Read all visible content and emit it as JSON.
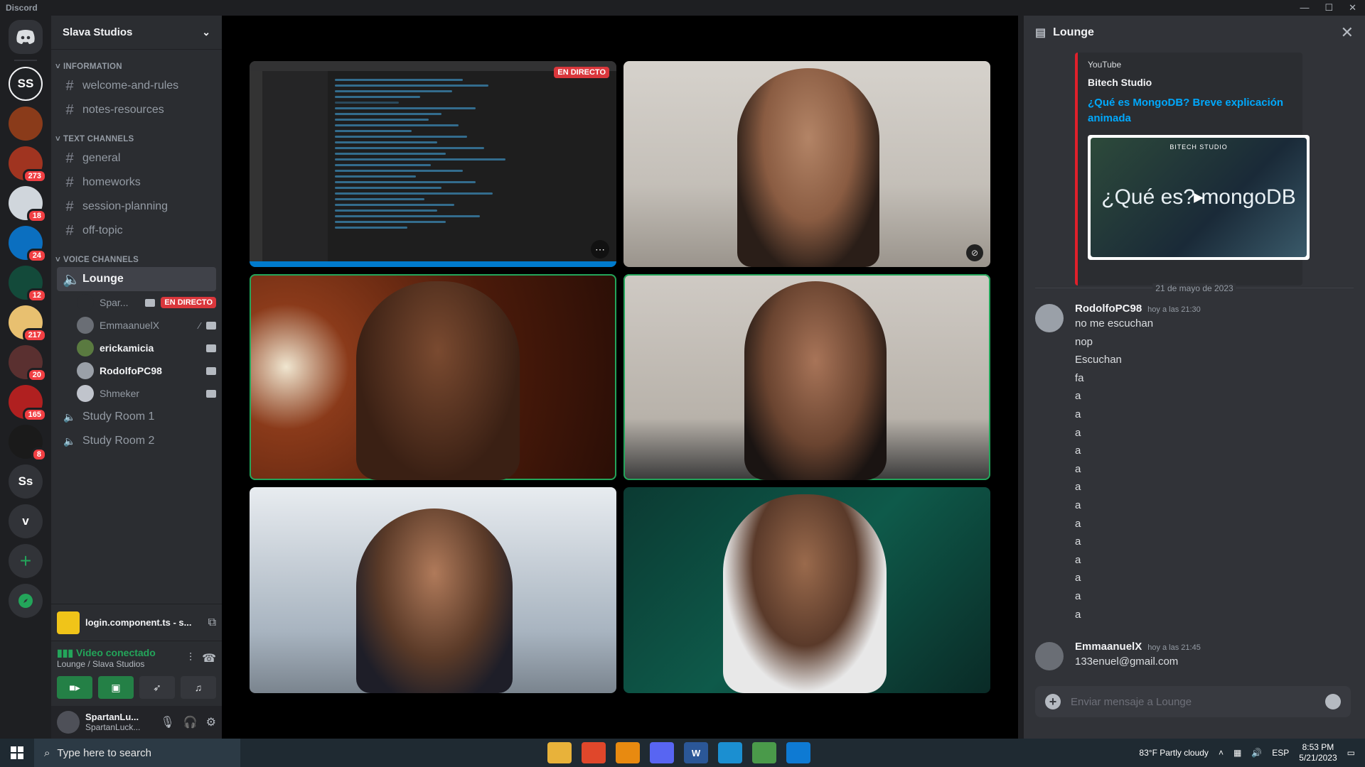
{
  "window": {
    "title": "Discord"
  },
  "rail": {
    "servers": [
      {
        "label": "SS",
        "color": "#202225",
        "badge": ""
      },
      {
        "label": "",
        "color": "#8a3b1a",
        "badge": ""
      },
      {
        "label": "",
        "color": "#a03420",
        "badge": "273"
      },
      {
        "label": "",
        "color": "#d0d6dc",
        "badge": "18"
      },
      {
        "label": "",
        "color": "#0b6fc0",
        "badge": "24"
      },
      {
        "label": "",
        "color": "#134a3a",
        "badge": "12"
      },
      {
        "label": "",
        "color": "#e8c070",
        "badge": "217"
      },
      {
        "label": "",
        "color": "#5a3030",
        "badge": "20"
      },
      {
        "label": "",
        "color": "#b02020",
        "badge": "165"
      },
      {
        "label": "",
        "color": "#1a1a1a",
        "badge": "8"
      }
    ],
    "initial_servers": [
      "Ss",
      "v"
    ]
  },
  "guild": {
    "name": "Slava Studios"
  },
  "categories": {
    "information": "INFORMATION",
    "text": "TEXT CHANNELS",
    "voice": "VOICE CHANNELS"
  },
  "info_channels": [
    "welcome-and-rules",
    "notes-resources"
  ],
  "text_channels": [
    "general",
    "homeworks",
    "session-planning",
    "off-topic"
  ],
  "voice_channels": {
    "active": "Lounge",
    "users": [
      {
        "name": "Spar...",
        "live": "EN DIRECTO",
        "bold": false,
        "color": "#2b2d31"
      },
      {
        "name": "EmmaanuelX",
        "live": "",
        "bold": false,
        "color": "#6a6e75"
      },
      {
        "name": "erickamicia",
        "live": "",
        "bold": true,
        "color": "#5a7a40"
      },
      {
        "name": "RodolfoPC98",
        "live": "",
        "bold": true,
        "color": "#9aa0a8"
      },
      {
        "name": "Shmeker",
        "live": "",
        "bold": false,
        "color": "#c0c4cc"
      }
    ],
    "others": [
      "Study Room 1",
      "Study Room 2"
    ]
  },
  "activity": {
    "title": "login.component.ts - s..."
  },
  "voice_panel": {
    "status": "Video conectado",
    "location": "Lounge / Slava Studios"
  },
  "user": {
    "display": "SpartanLu...",
    "username": "SpartanLuck..."
  },
  "stage": {
    "live_label": "EN DIRECTO"
  },
  "chat": {
    "channel": "Lounge",
    "embed": {
      "provider": "YouTube",
      "author": "Bitech Studio",
      "title": "¿Qué es MongoDB? Breve explicación animada",
      "thumb_brand": "BITECH STUDIO",
      "thumb_text": "¿Qué es? mongoDB"
    },
    "date_divider": "21 de mayo de 2023",
    "messages": [
      {
        "author": "RodolfoPC98",
        "time": "hoy a las 21:30",
        "lines": [
          "no me escuchan",
          "nop",
          "Escuchan",
          "fa",
          "a",
          "a",
          "a",
          "a",
          "a",
          "a",
          "a",
          "a",
          "a",
          "a",
          "a",
          "a",
          "a"
        ]
      },
      {
        "author": "EmmaanuelX",
        "time": "hoy a las 21:45",
        "lines": [
          "133enuel@gmail.com"
        ]
      }
    ],
    "placeholder": "Enviar mensaje a Lounge"
  },
  "taskbar": {
    "search_placeholder": "Type here to search",
    "weather": "83°F  Partly cloudy",
    "lang": "ESP",
    "time": "8:53 PM",
    "date": "5/21/2023",
    "apps": [
      {
        "name": "file-explorer",
        "color": "#e8b23a",
        "label": ""
      },
      {
        "name": "brave",
        "color": "#e0472b",
        "label": ""
      },
      {
        "name": "vlc",
        "color": "#e88a10",
        "label": ""
      },
      {
        "name": "discord",
        "color": "#5865f2",
        "label": ""
      },
      {
        "name": "word",
        "color": "#2b5797",
        "label": "W"
      },
      {
        "name": "edge",
        "color": "#1b8fd1",
        "label": ""
      },
      {
        "name": "git-tool",
        "color": "#4a9a4a",
        "label": ""
      },
      {
        "name": "vscode",
        "color": "#0e7ad3",
        "label": ""
      }
    ]
  }
}
